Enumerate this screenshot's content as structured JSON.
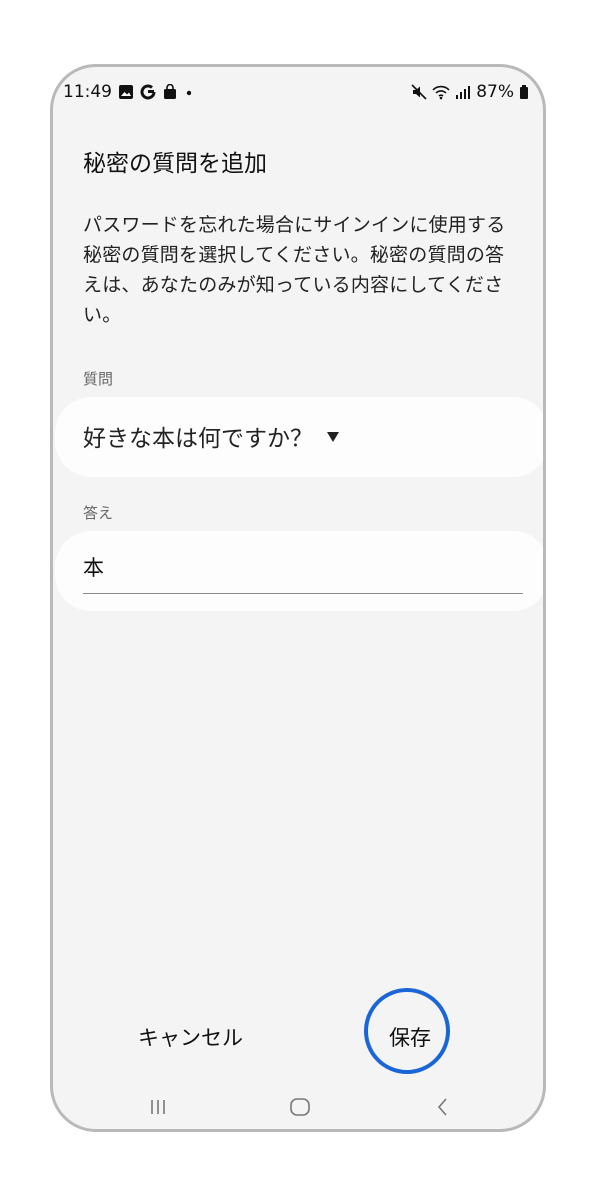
{
  "status_bar": {
    "time": "11:49",
    "battery": "87%",
    "left_icons": [
      "image-icon",
      "google-icon",
      "shopping-bag-icon",
      "dot-icon"
    ],
    "right_icons": [
      "mute-icon",
      "wifi-icon",
      "signal-icon",
      "battery-icon"
    ]
  },
  "page": {
    "title": "秘密の質問を追加",
    "description": "パスワードを忘れた場合にサインインに使用する秘密の質問を選択してください。秘密の質問の答えは、あなたのみが知っている内容にしてください。"
  },
  "question": {
    "label": "質問",
    "selected": "好きな本は何ですか？"
  },
  "answer": {
    "label": "答え",
    "value": "本"
  },
  "actions": {
    "cancel_label": "キャンセル",
    "save_label": "保存"
  },
  "nav_bar": {
    "icons": [
      "recent-apps-icon",
      "home-icon",
      "back-icon"
    ]
  },
  "colors": {
    "highlight": "#1a66d8",
    "background": "#f4f4f4",
    "card": "#fdfdfd"
  }
}
